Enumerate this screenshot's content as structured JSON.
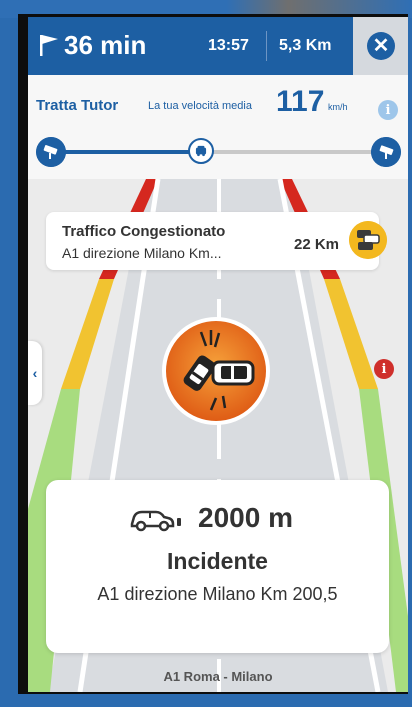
{
  "header": {
    "eta": "36 min",
    "clock": "13:57",
    "distance": "5,3 Km",
    "color": "#1d5fa3"
  },
  "tutor": {
    "title": "Tratta Tutor",
    "speed_label": "La tua velocità media",
    "speed_value": "117",
    "speed_unit": "km/h",
    "progress": 0.45
  },
  "traffic": {
    "title": "Traffico Congestionato",
    "road": "A1 direzione Milano Km...",
    "distance": "22 Km",
    "icon": "traffic-jam-icon",
    "icon_color": "#f3b81f"
  },
  "incident": {
    "distance": "2000 m",
    "type": "Incidente",
    "location": "A1 direzione Milano Km 200,5",
    "icon": "car-crash-icon",
    "icon_color": "#e8681e"
  },
  "road_name": "A1 Roma - Milano",
  "colors": {
    "congestion_red": "#d5281f",
    "congestion_yellow": "#f1c330",
    "free_green": "#a8dc7f",
    "alert": "#cf2f2b"
  }
}
